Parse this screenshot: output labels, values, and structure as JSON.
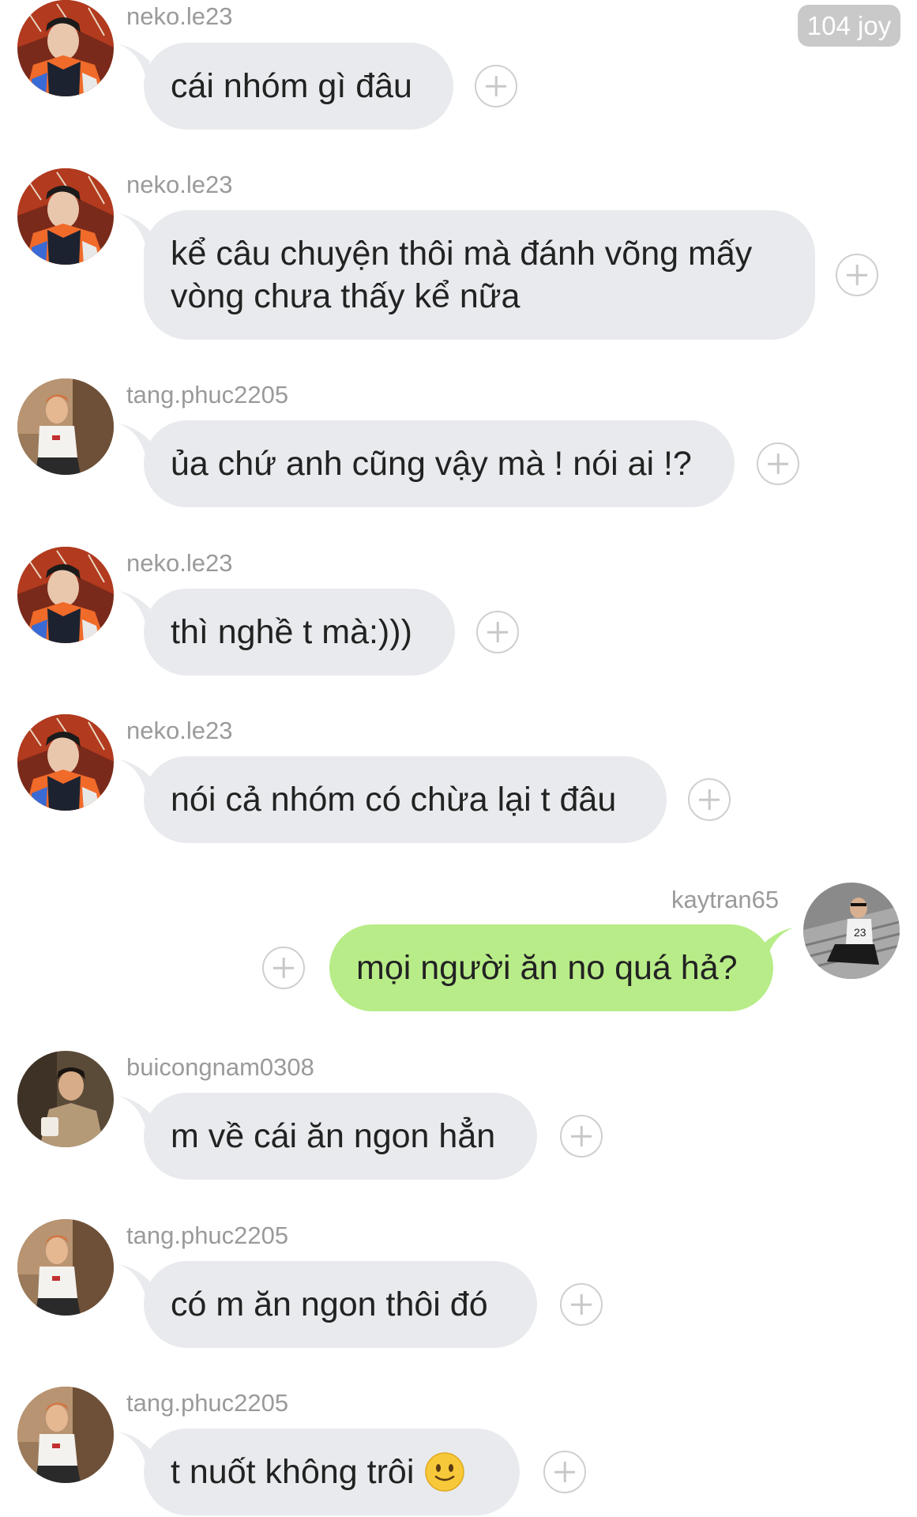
{
  "header": {
    "joy_badge": "104 joy"
  },
  "messages": [
    {
      "user": "neko.le23",
      "text": "cái nhóm gì đâu",
      "side": "left",
      "avatar_icon": "avatar-neko"
    },
    {
      "user": "neko.le23",
      "text": "kể câu chuyện thôi mà đánh võng mấy vòng chưa thấy kể nữa",
      "side": "left",
      "avatar_icon": "avatar-neko"
    },
    {
      "user": "tang.phuc2205",
      "text": "ủa chứ anh cũng vậy mà ! nói ai !?",
      "side": "left",
      "avatar_icon": "avatar-tang"
    },
    {
      "user": "neko.le23",
      "text": "thì nghề t mà:)))",
      "side": "left",
      "avatar_icon": "avatar-neko"
    },
    {
      "user": "neko.le23",
      "text": "nói cả nhóm có chừa lại t đâu",
      "side": "left",
      "avatar_icon": "avatar-neko"
    },
    {
      "user": "kaytran65",
      "text": "mọi người ăn no quá hả?",
      "side": "right",
      "avatar_icon": "avatar-kay"
    },
    {
      "user": "buicongnam0308",
      "text": "m về cái ăn ngon hẳn",
      "side": "left",
      "avatar_icon": "avatar-bui"
    },
    {
      "user": "tang.phuc2205",
      "text": "có m ăn ngon thôi đó",
      "side": "left",
      "avatar_icon": "avatar-tang"
    },
    {
      "user": "tang.phuc2205",
      "text": "t nuốt không trôi",
      "side": "left",
      "avatar_icon": "avatar-tang",
      "emoji": "slightly-smiling-face-icon"
    }
  ],
  "colors": {
    "incoming_bubble": "#e8eaed",
    "outgoing_bubble": "#b8ec88",
    "username": "#9a9a9a",
    "badge": "#c9c9c9"
  }
}
